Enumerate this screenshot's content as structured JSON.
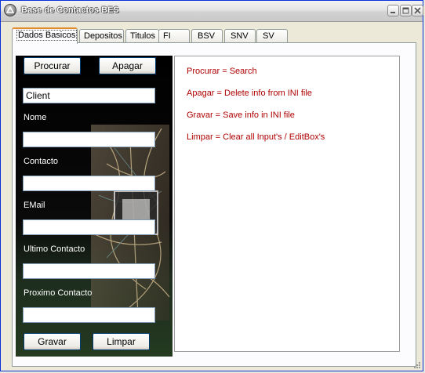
{
  "window": {
    "title": "Base de Contactos BES"
  },
  "tabs": [
    {
      "label": "Dados Basicos",
      "active": true
    },
    {
      "label": "Depositos"
    },
    {
      "label": "Titulos"
    },
    {
      "label": "FI"
    },
    {
      "label": "BSV"
    },
    {
      "label": "SNV"
    },
    {
      "label": "SV"
    }
  ],
  "form": {
    "procurar_label": "Procurar",
    "apagar_label": "Apagar",
    "client_value": "Client",
    "nome_label": "Nome",
    "nome_value": "",
    "contacto_label": "Contacto",
    "contacto_value": "",
    "email_label": "EMail",
    "email_value": "",
    "ultimo_label": "Ultimo Contacto",
    "ultimo_value": "",
    "proximo_label": "Proximo Contacto",
    "proximo_value": "",
    "gravar_label": "Gravar",
    "limpar_label": "Limpar"
  },
  "help": [
    "Procurar = Search",
    "Apagar = Delete info from INI file",
    "Gravar = Save info in INI file",
    "Limpar = Clear all Input's / EditBox's"
  ],
  "colors": {
    "help_text": "#b00000",
    "titlebar_text": "#ffffff",
    "active_tab_accent": "#e68b2c"
  },
  "icons": [
    "app-icon",
    "minimize-icon",
    "maximize-icon",
    "close-icon",
    "resize-grip-icon"
  ]
}
